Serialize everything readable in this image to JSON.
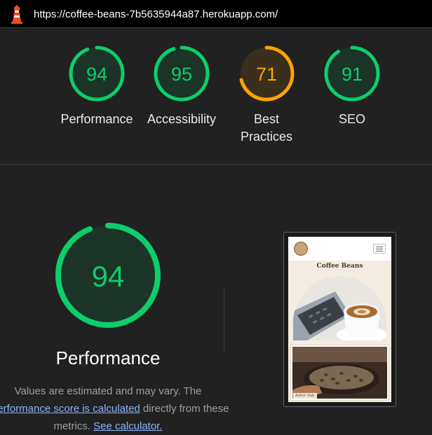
{
  "header": {
    "url": "https://coffee-beans-7b5635944a87.herokuapp.com/",
    "icon": "lighthouse-icon"
  },
  "scores": [
    {
      "value": 94,
      "label": "Performance",
      "color": "#0cce6b",
      "bg": "#1c3327"
    },
    {
      "value": 95,
      "label": "Accessibility",
      "color": "#0cce6b",
      "bg": "#1c3327"
    },
    {
      "value": 71,
      "label_line1": "Best",
      "label_line2": "Practices",
      "color": "#ffa400",
      "bg": "#3a2f1c"
    },
    {
      "value": 91,
      "label": "SEO",
      "color": "#0cce6b",
      "bg": "#1c3327"
    }
  ],
  "detail": {
    "score": 94,
    "title": "Performance",
    "desc_line1": "Values are estimated and may vary. The",
    "desc_link1": "performance score is calculated",
    "desc_mid": " directly from these",
    "desc_line3_prefix": "metrics. ",
    "desc_link2": "See calculator."
  },
  "screenshot": {
    "site_title": "Coffee Beans",
    "author": "Author: Katy"
  },
  "colors": {
    "pass": "#0cce6b",
    "average": "#ffa400",
    "link": "#8ab4f8"
  }
}
